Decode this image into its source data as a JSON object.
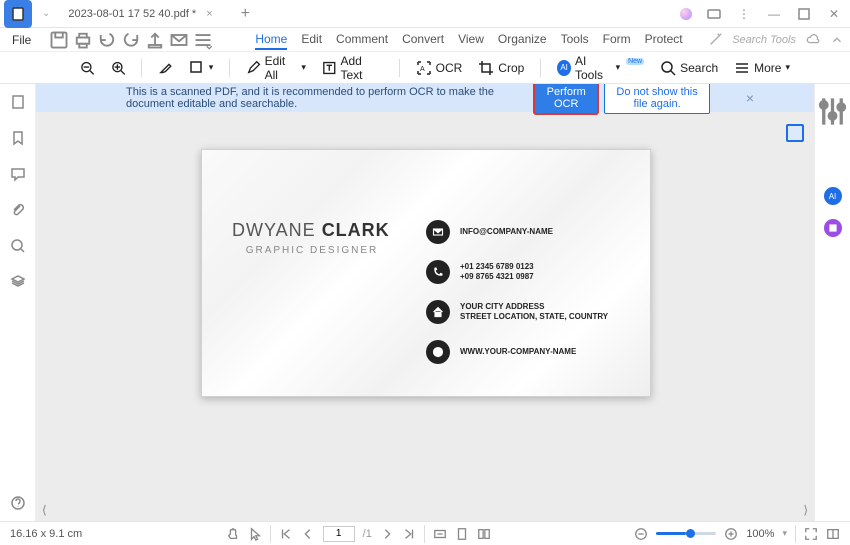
{
  "tab": {
    "title": "2023-08-01 17 52 40.pdf *"
  },
  "menu": {
    "file": "File",
    "tabs": [
      "Home",
      "Edit",
      "Comment",
      "Convert",
      "View",
      "Organize",
      "Tools",
      "Form",
      "Protect"
    ],
    "active": "Home",
    "search_placeholder": "Search Tools"
  },
  "ribbon": {
    "edit_all": "Edit All",
    "add_text": "Add Text",
    "ocr": "OCR",
    "crop": "Crop",
    "ai_tools": "AI Tools",
    "search": "Search",
    "more": "More"
  },
  "notice": {
    "msg": "This is a scanned PDF, and it is recommended to perform OCR to make the document editable and searchable.",
    "perform": "Perform OCR",
    "dismiss": "Do not show this file again."
  },
  "card": {
    "first": "DWYANE",
    "last": "CLARK",
    "role": "GRAPHIC DESIGNER",
    "email": "INFO@COMPANY-NAME",
    "phone1": "+01 2345 6789 0123",
    "phone2": "+09 8765 4321 0987",
    "addr1": "YOUR CITY ADDRESS",
    "addr2": "STREET LOCATION, STATE, COUNTRY",
    "web": "WWW.YOUR-COMPANY-NAME"
  },
  "status": {
    "dims": "16.16 x 9.1 cm",
    "page": "1",
    "pages": "/1",
    "zoom": "100%"
  },
  "icons": {
    "ai": "AI",
    "new": "New"
  }
}
